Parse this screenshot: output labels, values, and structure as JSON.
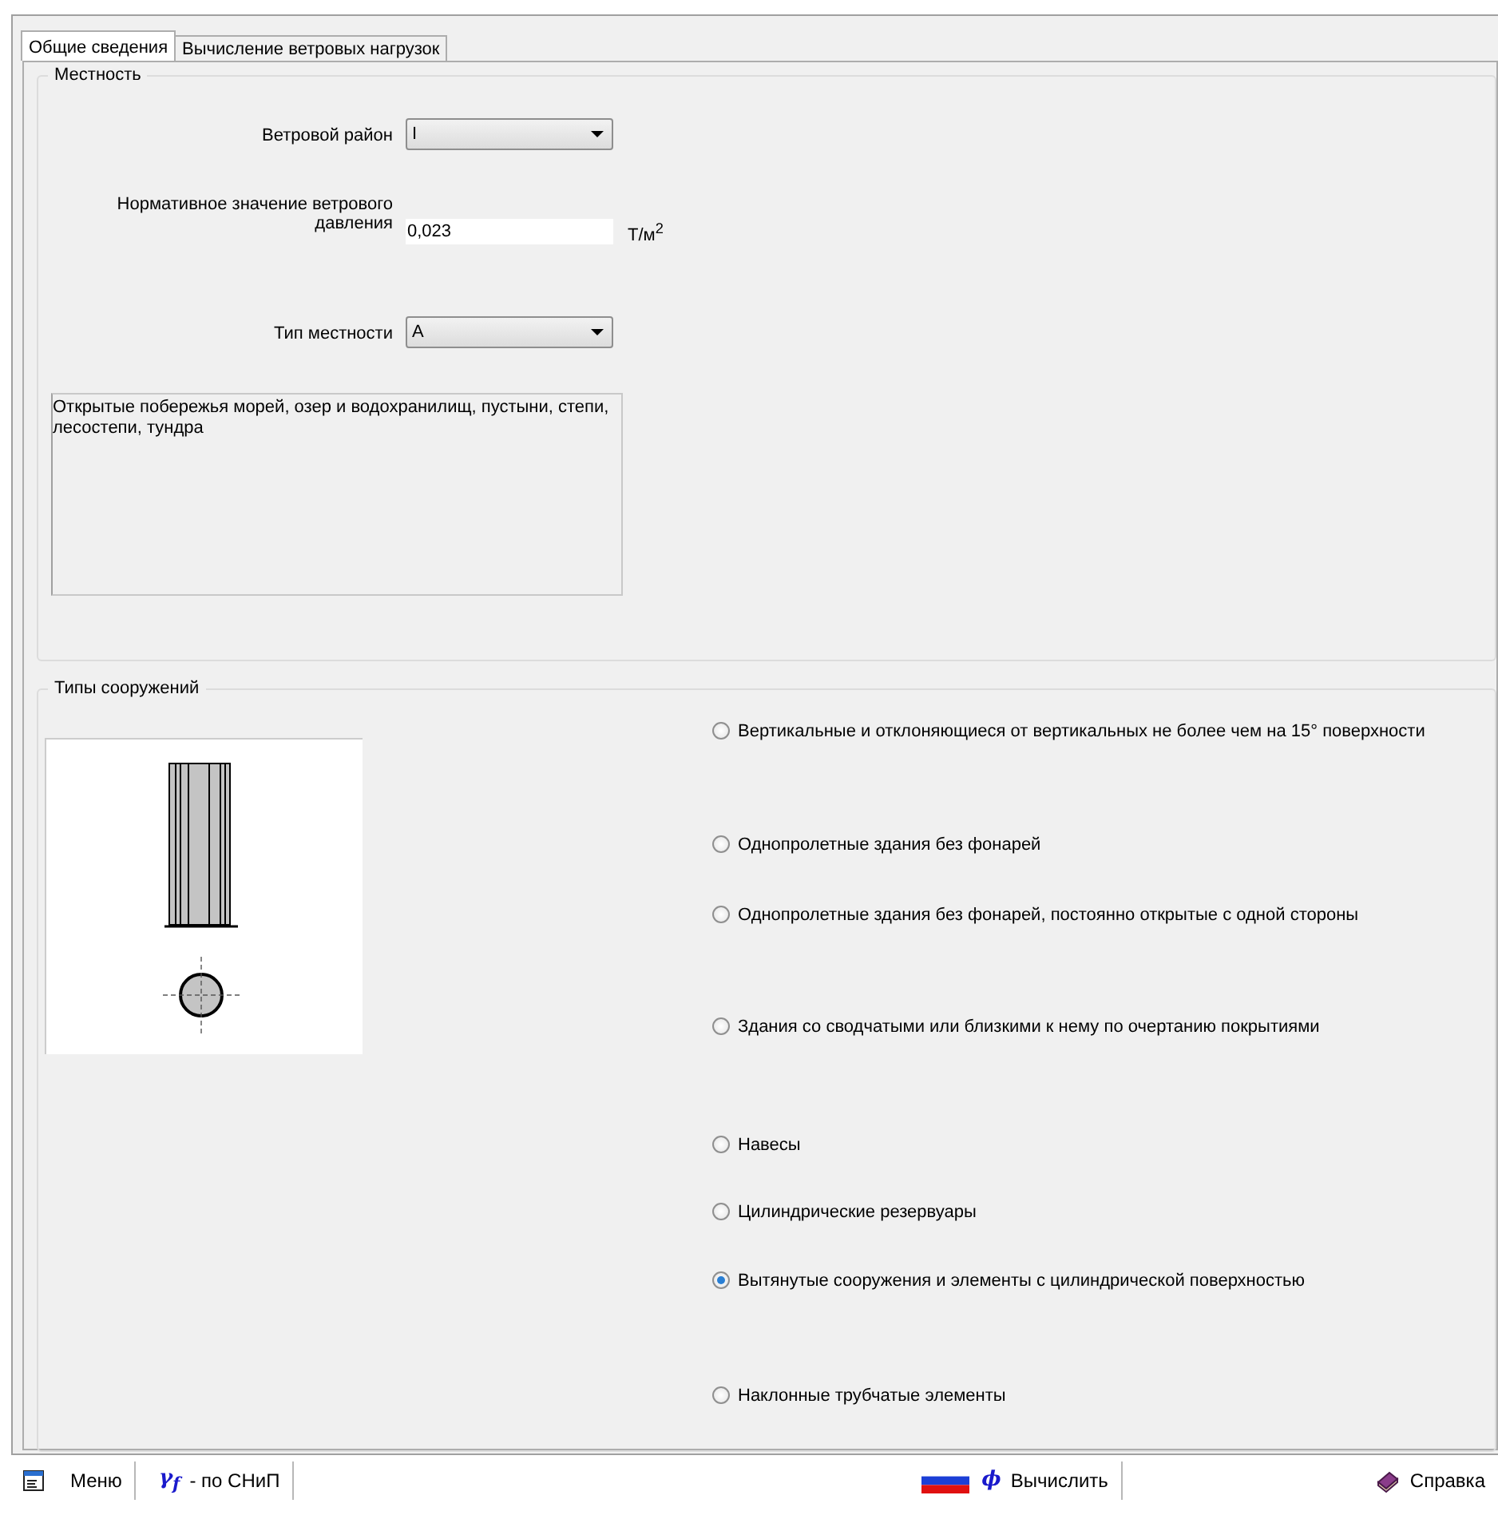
{
  "tabs": [
    {
      "label": "Общие сведения",
      "selected": true
    },
    {
      "label": "Вычисление ветровых нагрузок",
      "selected": false
    }
  ],
  "terrain": {
    "title": "Местность",
    "wind_region": {
      "label": "Ветровой район",
      "value": "I"
    },
    "pressure": {
      "label": "Нормативное значение ветрового давления",
      "value": "0,023",
      "unit": "Т/м$^{2}$"
    },
    "terrain_type": {
      "label": "Тип местности",
      "value": "A"
    },
    "description": "Открытые побережья морей, озер и водохранилищ, пустыни, степи, лесостепи, тундра"
  },
  "structures": {
    "title": "Типы сооружений",
    "options": [
      {
        "label": "Вертикальные и отклоняющиеся от вертикальных не более чем на 15° поверхности",
        "selected": false
      },
      {
        "label": "Однопролетные здания без фонарей",
        "selected": false
      },
      {
        "label": "Однопролетные здания без фонарей, постоянно открытые с одной стороны",
        "selected": false
      },
      {
        "label": "Здания со сводчатыми или близкими к нему по очертанию покрытиями",
        "selected": false
      },
      {
        "label": "Навесы",
        "selected": false
      },
      {
        "label": "Цилиндрические резервуары",
        "selected": false
      },
      {
        "label": "Вытянутые сооружения и элементы с цилиндрической поверхностью",
        "selected": true
      },
      {
        "label": "Наклонные трубчатые элементы",
        "selected": false
      }
    ]
  },
  "status_bar": {
    "menu": "Меню",
    "coef_symbol": "γ$_{f}$",
    "coef_label": "- по СНиП",
    "calc_symbol": "ϕ",
    "calc": "Вычислить",
    "help": "Справка"
  }
}
